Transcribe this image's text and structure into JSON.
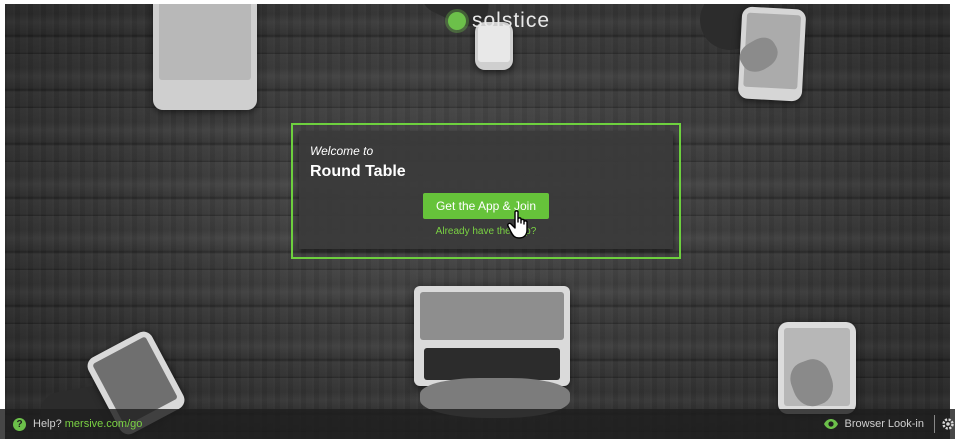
{
  "brand": {
    "name": "solstice",
    "accent": "#6cc04a"
  },
  "welcome_card": {
    "welcome_text": "Welcome to",
    "room_name": "Round Table",
    "join_button_label": "Get the App & Join",
    "already_have_link": "Already have the App?"
  },
  "footer": {
    "help_prefix": "Help?",
    "help_link": "mersive.com/go",
    "browser_look_in": "Browser Look-in"
  },
  "icons": [
    "help-icon",
    "eye-icon",
    "gear-icon",
    "hand-cursor-icon"
  ]
}
